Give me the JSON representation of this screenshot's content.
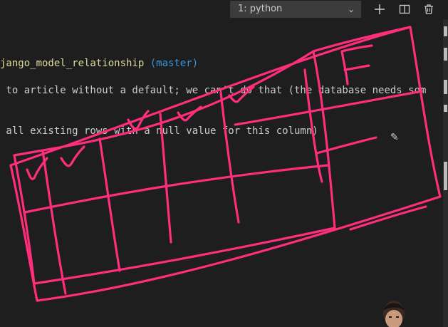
{
  "terminal_selector": {
    "value": "1: python"
  },
  "toolbar": {
    "new_terminal_icon": "plus-icon",
    "split_terminal_icon": "split-icon",
    "kill_terminal_icon": "trash-icon"
  },
  "terminal": {
    "prompt_path": "jango_model_relationship",
    "prompt_branch": "(master)",
    "line1": " to article without a default; we can't do that (the database needs som",
    "line2": " all existing rows with a null value for this column)"
  },
  "annotation": {
    "letter": "F"
  },
  "colors": {
    "background": "#1e1e1e",
    "ink": "#ff2e7a",
    "path": "#dcdc9a",
    "branch": "#3a96dd"
  }
}
